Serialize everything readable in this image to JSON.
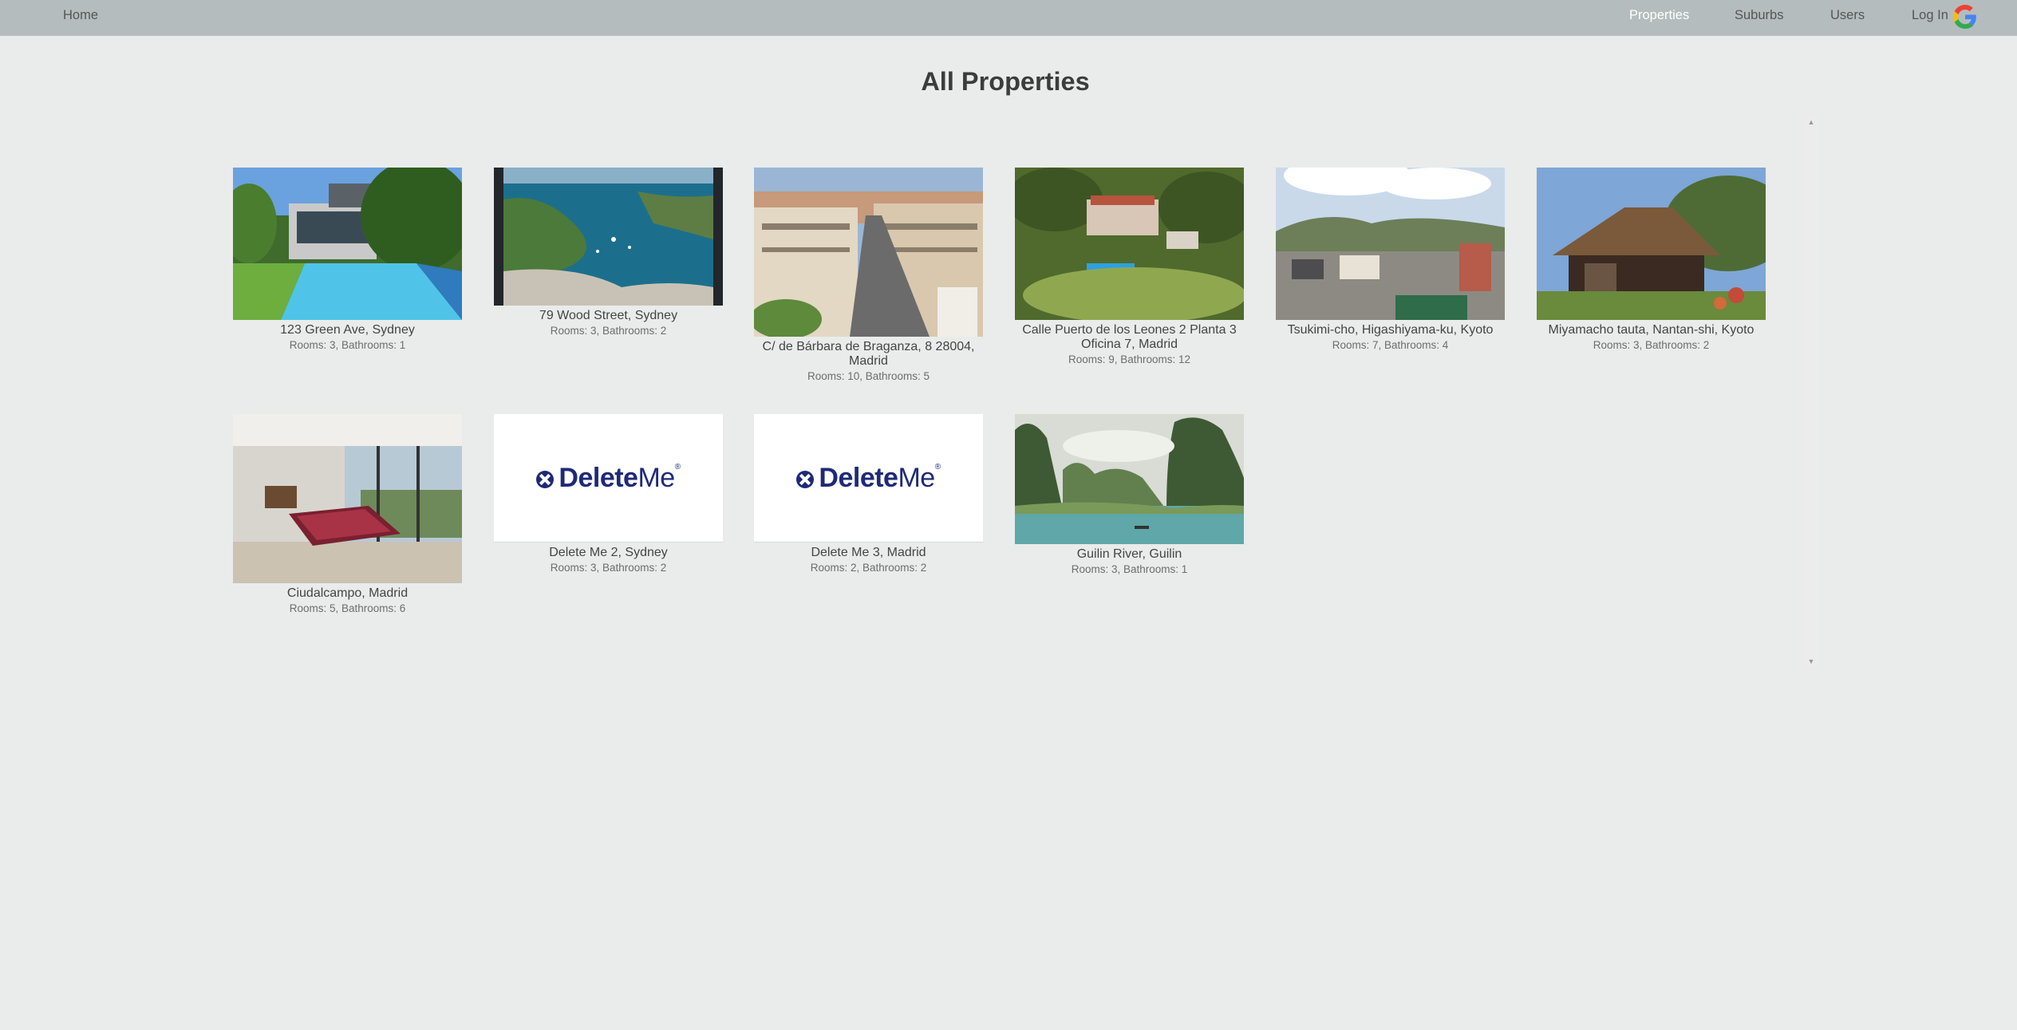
{
  "nav": {
    "home": "Home",
    "properties": "Properties",
    "suburbs": "Suburbs",
    "users": "Users",
    "login": "Log In"
  },
  "page": {
    "title": "All Properties"
  },
  "properties": [
    {
      "name": "123 Green Ave, Sydney",
      "info": "Rooms: 3, Bathrooms: 1",
      "image": "pool-house-photo"
    },
    {
      "name": "79 Wood Street, Sydney",
      "info": "Rooms: 3, Bathrooms: 2",
      "image": "harbour-aerial-photo"
    },
    {
      "name": "C/ de Bárbara de Braganza, 8 28004, Madrid",
      "info": "Rooms: 10, Bathrooms: 5",
      "image": "madrid-street-photo"
    },
    {
      "name": "Calle Puerto de los Leones 2 Planta 3 Oficina 7, Madrid",
      "info": "Rooms: 9, Bathrooms: 12",
      "image": "estate-aerial-photo"
    },
    {
      "name": "Tsukimi-cho, Higashiyama-ku, Kyoto",
      "info": "Rooms: 7, Bathrooms: 4",
      "image": "kyoto-town-photo"
    },
    {
      "name": "Miyamacho tauta, Nantan-shi, Kyoto",
      "info": "Rooms: 3, Bathrooms: 2",
      "image": "thatched-house-photo"
    },
    {
      "name": "Ciudalcampo, Madrid",
      "info": "Rooms: 5, Bathrooms: 6",
      "image": "billiard-room-photo"
    },
    {
      "name": "Delete Me 2, Sydney",
      "info": "Rooms: 3, Bathrooms: 2",
      "image": "deleteme-logo"
    },
    {
      "name": "Delete Me 3, Madrid",
      "info": "Rooms: 2, Bathrooms: 2",
      "image": "deleteme-logo"
    },
    {
      "name": "Guilin River, Guilin",
      "info": "Rooms: 3, Bathrooms: 1",
      "image": "guilin-river-photo"
    }
  ],
  "logo_text": {
    "bold": "Delete",
    "light": "Me",
    "reg": "®"
  },
  "colors": {
    "navbar": "#b5bcbd",
    "background": "#e9ecea",
    "active_nav": "#ffffff",
    "logo_blue": "#1e2a78"
  }
}
